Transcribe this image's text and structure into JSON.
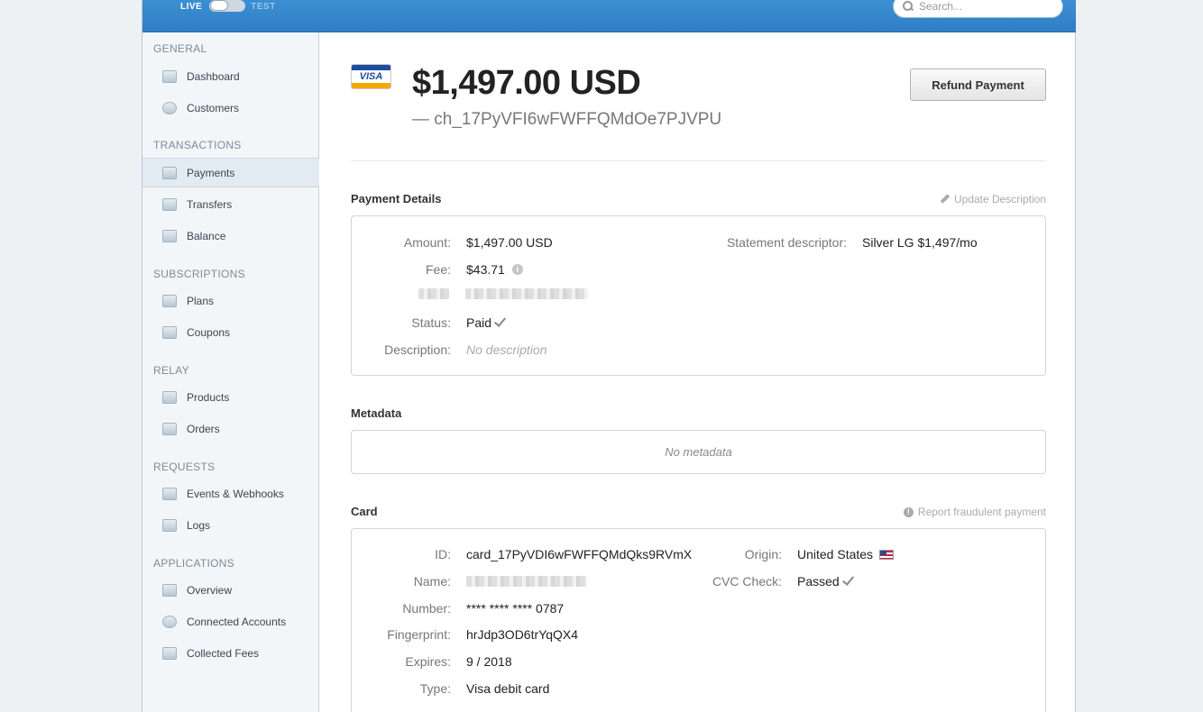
{
  "topbar": {
    "live_label": "LIVE",
    "test_label": "TEST",
    "search_placeholder": "Search..."
  },
  "sidebar": {
    "sections": [
      {
        "title": "GENERAL",
        "items": [
          "Dashboard",
          "Customers"
        ]
      },
      {
        "title": "TRANSACTIONS",
        "items": [
          "Payments",
          "Transfers",
          "Balance"
        ]
      },
      {
        "title": "SUBSCRIPTIONS",
        "items": [
          "Plans",
          "Coupons"
        ]
      },
      {
        "title": "RELAY",
        "items": [
          "Products",
          "Orders"
        ]
      },
      {
        "title": "REQUESTS",
        "items": [
          "Events & Webhooks",
          "Logs"
        ]
      },
      {
        "title": "APPLICATIONS",
        "items": [
          "Overview",
          "Connected Accounts",
          "Collected Fees"
        ]
      }
    ],
    "active_item": "Payments"
  },
  "header": {
    "card_brand": "VISA",
    "amount": "$1,497.00 USD",
    "charge_id": "— ch_17PyVFI6wFWFFQMdOe7PJVPU",
    "refund_label": "Refund Payment"
  },
  "payment_details": {
    "title": "Payment Details",
    "update_link": "Update Description",
    "amount_label": "Amount:",
    "amount_value": "$1,497.00 USD",
    "fee_label": "Fee:",
    "fee_value": "$43.71",
    "status_label": "Status:",
    "status_value": "Paid",
    "description_label": "Description:",
    "description_value": "No description",
    "descriptor_label": "Statement descriptor:",
    "descriptor_value": "Silver LG $1,497/mo"
  },
  "metadata": {
    "title": "Metadata",
    "empty_text": "No metadata"
  },
  "card": {
    "title": "Card",
    "report_link": "Report fraudulent payment",
    "id_label": "ID:",
    "id_value": "card_17PyVDI6wFWFFQMdQks9RVmX",
    "name_label": "Name:",
    "number_label": "Number:",
    "number_value": "**** **** **** 0787",
    "fingerprint_label": "Fingerprint:",
    "fingerprint_value": "hrJdp3OD6trYqQX4",
    "expires_label": "Expires:",
    "expires_value": "9 / 2018",
    "type_label": "Type:",
    "type_value": "Visa debit card",
    "origin_label": "Origin:",
    "origin_value": "United States",
    "cvc_label": "CVC Check:",
    "cvc_value": "Passed"
  }
}
